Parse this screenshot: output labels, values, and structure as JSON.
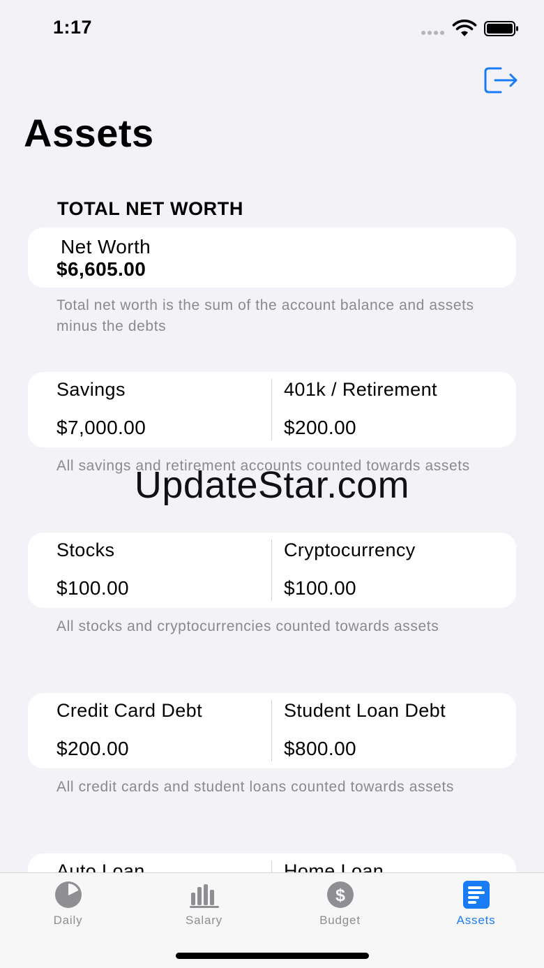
{
  "status_bar": {
    "time": "1:17"
  },
  "header": {
    "title": "Assets",
    "logout_icon": "logout-icon"
  },
  "net_worth": {
    "section_header": "TOTAL NET WORTH",
    "label": "Net Worth",
    "value": "$6,605.00",
    "footer": "Total net worth is the sum of the account balance and assets minus the debts"
  },
  "groups": [
    {
      "left": {
        "label": "Savings",
        "value": "$7,000.00"
      },
      "right": {
        "label": "401k / Retirement",
        "value": "$200.00"
      },
      "footer": "All savings and retirement accounts counted towards assets"
    },
    {
      "left": {
        "label": "Stocks",
        "value": "$100.00"
      },
      "right": {
        "label": "Cryptocurrency",
        "value": "$100.00"
      },
      "footer": "All stocks and cryptocurrencies counted towards assets"
    },
    {
      "left": {
        "label": "Credit Card Debt",
        "value": "$200.00"
      },
      "right": {
        "label": "Student Loan Debt",
        "value": "$800.00"
      },
      "footer": "All credit cards and student loans counted towards assets"
    },
    {
      "left": {
        "label": "Auto Loan",
        "value": ""
      },
      "right": {
        "label": "Home Loan",
        "value": ""
      },
      "footer": ""
    }
  ],
  "watermark": "UpdateStar.com",
  "tab_bar": {
    "tabs": [
      {
        "label": "Daily",
        "icon": "pie-chart-icon",
        "active": false
      },
      {
        "label": "Salary",
        "icon": "bar-chart-icon",
        "active": false
      },
      {
        "label": "Budget",
        "icon": "dollar-circle-icon",
        "active": false
      },
      {
        "label": "Assets",
        "icon": "list-document-icon",
        "active": true
      }
    ]
  },
  "colors": {
    "accent": "#1a7cf5",
    "inactive": "#8e8e93",
    "background": "#f2f2f7",
    "card": "#ffffff"
  }
}
